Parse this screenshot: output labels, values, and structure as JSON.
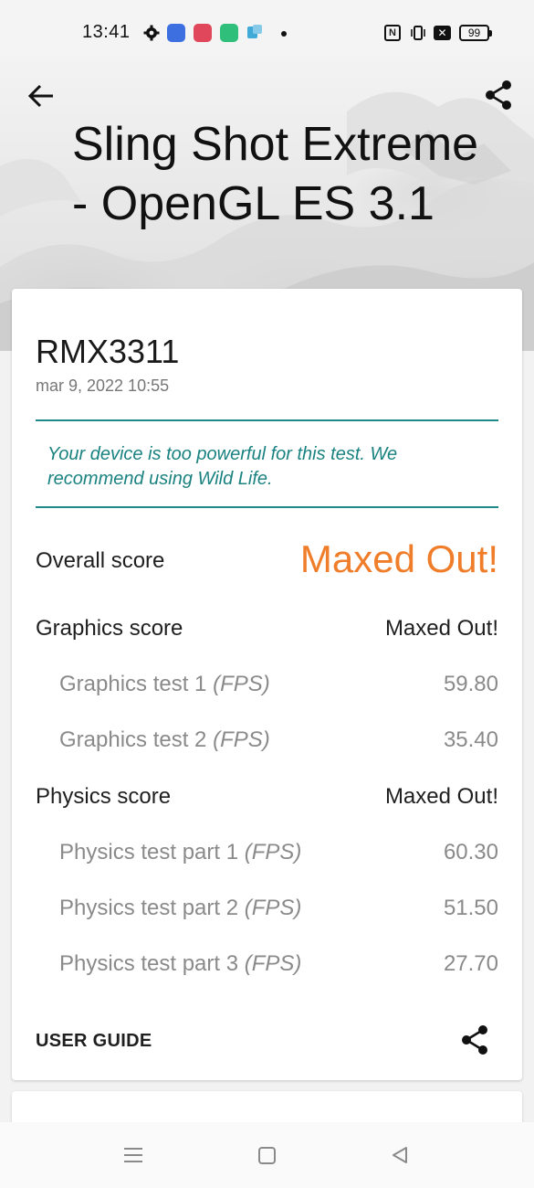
{
  "status_bar": {
    "time": "13:41",
    "nfc_label": "N",
    "battery": "99",
    "icons": [
      "gear-icon",
      "app-icon",
      "app-icon",
      "app-icon",
      "app-icon",
      "dot-icon",
      "nfc-icon",
      "vibrate-icon",
      "no-sim-icon",
      "battery-icon"
    ]
  },
  "header": {
    "title": "Sling Shot Extreme - OpenGL ES 3.1",
    "back_icon": "arrow-left-icon",
    "share_icon": "share-icon"
  },
  "result": {
    "device": "RMX3311",
    "date": "mar 9, 2022 10:55",
    "notice": "Your device is too powerful for this test. We recommend using Wild Life.",
    "overall": {
      "label": "Overall score",
      "value": "Maxed Out!"
    },
    "graphics": {
      "label": "Graphics score",
      "value": "Maxed Out!",
      "tests": [
        {
          "label": "Graphics test 1",
          "unit": "(FPS)",
          "value": "59.80"
        },
        {
          "label": "Graphics test 2",
          "unit": "(FPS)",
          "value": "35.40"
        }
      ]
    },
    "physics": {
      "label": "Physics score",
      "value": "Maxed Out!",
      "tests": [
        {
          "label": "Physics test part 1",
          "unit": "(FPS)",
          "value": "60.30"
        },
        {
          "label": "Physics test part 2",
          "unit": "(FPS)",
          "value": "51.50"
        },
        {
          "label": "Physics test part 3",
          "unit": "(FPS)",
          "value": "27.70"
        }
      ]
    },
    "user_guide": "USER GUIDE"
  },
  "colors": {
    "accent_orange": "#f07d2a",
    "notice_teal": "#1a8280"
  },
  "nav_bar": {
    "icons": [
      "menu-icon",
      "home-icon",
      "back-triangle-icon"
    ]
  }
}
